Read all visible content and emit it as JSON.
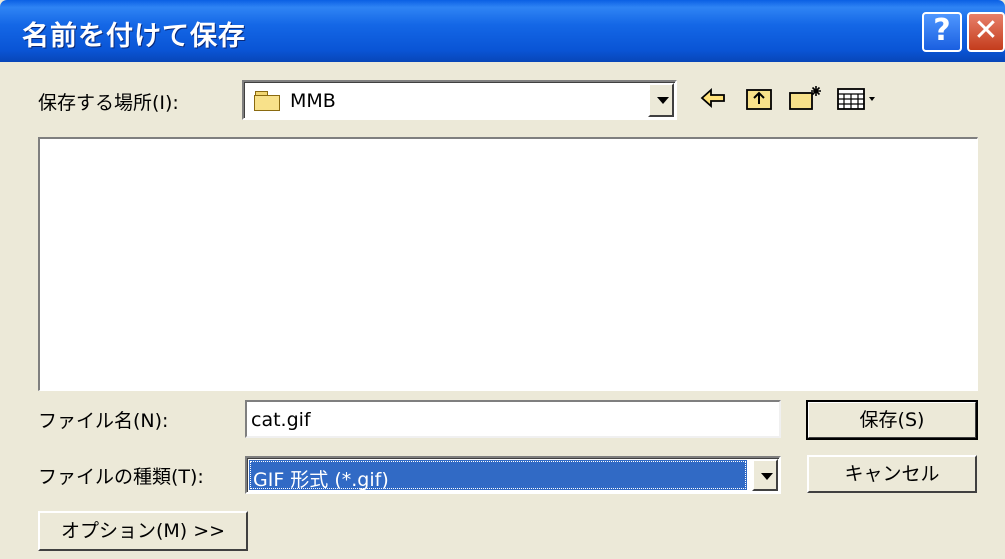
{
  "dialog": {
    "title": "名前を付けて保存",
    "help_label": "?",
    "close_label": "✕"
  },
  "save_in": {
    "label": "保存する場所(I):",
    "value": "MMB"
  },
  "toolbar": {
    "back_icon": "back-arrow-icon",
    "up_icon": "up-folder-icon",
    "new_folder_icon": "new-folder-icon",
    "view_menu_icon": "view-menu-icon"
  },
  "file_list": {
    "items": []
  },
  "filename": {
    "label": "ファイル名(N):",
    "value": "cat.gif"
  },
  "filetype": {
    "label": "ファイルの種類(T):",
    "value": "GIF 形式 (*.gif)"
  },
  "buttons": {
    "save": "保存(S)",
    "cancel": "キャンセル",
    "options": "オプション(M) >>"
  },
  "colors": {
    "title_bar": "#1467e6",
    "dialog_bg": "#ece9d8",
    "selection": "#316ac5"
  }
}
